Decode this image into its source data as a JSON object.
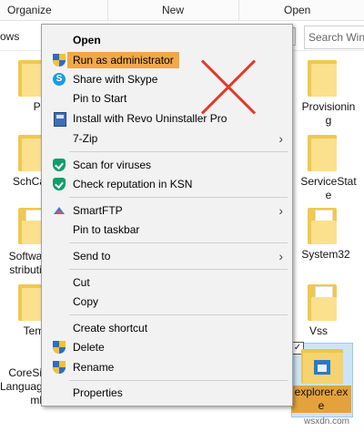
{
  "ribbon": {
    "groups": [
      "Organize",
      "New",
      "Open"
    ]
  },
  "address": {
    "path_fragment": "ows",
    "search_placeholder": "Search Wind"
  },
  "files_left": [
    {
      "label_lines": [
        "PLA"
      ]
    },
    {
      "label_lines": [
        "SchCa"
      ]
    },
    {
      "label_lines": [
        "Softwa",
        "stributi"
      ]
    },
    {
      "label_lines": [
        "Tem"
      ]
    },
    {
      "label_lines": [
        "CoreSi",
        "Languageli",
        "ml"
      ]
    }
  ],
  "files_right": [
    {
      "label_lines": [
        "Provisionin",
        "g"
      ]
    },
    {
      "label_lines": [
        "ServiceStat",
        "e"
      ]
    },
    {
      "label_lines": [
        "System32"
      ]
    },
    {
      "label_lines": [
        "Vss"
      ]
    }
  ],
  "selected_file": {
    "label_lines": [
      "explorer.ex",
      "e"
    ],
    "checked_glyph": "✓"
  },
  "context_menu": {
    "items": [
      {
        "label": "Open"
      },
      {
        "label": "Run as administrator",
        "icon": "uac-shield-icon",
        "highlighted": true
      },
      {
        "label": "Share with Skype",
        "icon": "skype-icon"
      },
      {
        "label": "Pin to Start"
      },
      {
        "label": "Install with Revo Uninstaller Pro",
        "icon": "revo-uninstaller-icon"
      },
      {
        "label": "7-Zip",
        "submenu": true
      },
      {
        "label": "Scan for viruses",
        "icon": "kaspersky-icon"
      },
      {
        "label": "Check reputation in KSN",
        "icon": "kaspersky-icon"
      },
      {
        "label": "SmartFTP",
        "icon": "smartftp-icon",
        "submenu": true
      },
      {
        "label": "Pin to taskbar"
      },
      {
        "label": "Send to",
        "submenu": true
      },
      {
        "label": "Cut"
      },
      {
        "label": "Copy"
      },
      {
        "label": "Create shortcut"
      },
      {
        "label": "Delete",
        "icon": "uac-shield-icon"
      },
      {
        "label": "Rename",
        "icon": "uac-shield-icon"
      },
      {
        "label": "Properties"
      }
    ],
    "submenu_glyph": "›"
  },
  "colors": {
    "highlight": "#f0a948",
    "annotation_cross": "#e23a2a",
    "selection": "#cce4f7"
  },
  "watermark": "wsxdn.com"
}
